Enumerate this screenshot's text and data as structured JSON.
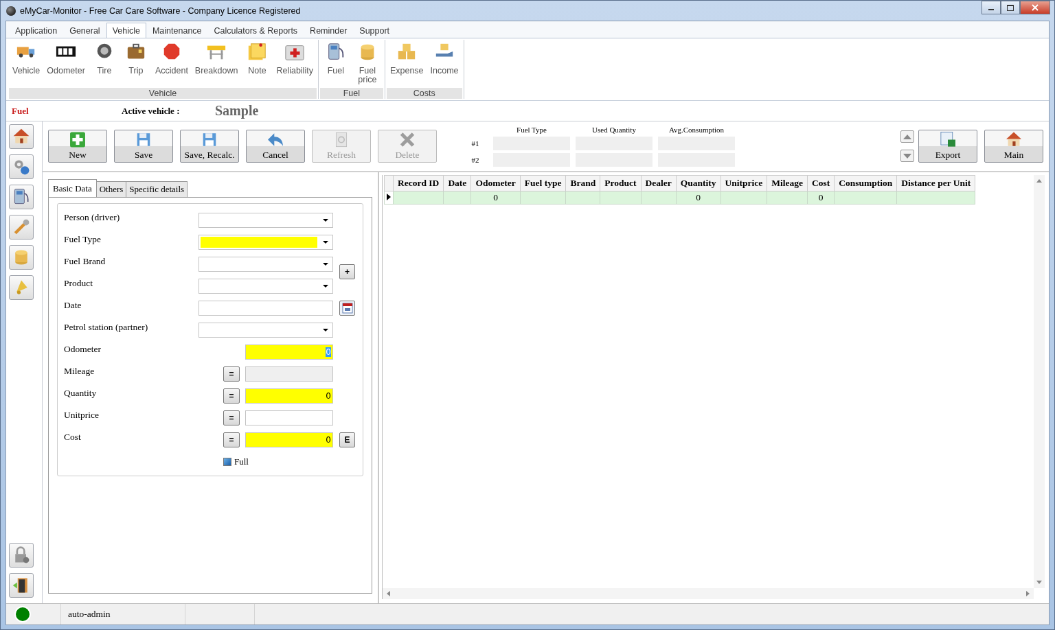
{
  "window": {
    "title": "eMyCar-Monitor - Free Car Care Software - Company Licence Registered"
  },
  "menu_tabs": [
    {
      "label": "Application",
      "selected": false
    },
    {
      "label": "General",
      "selected": false
    },
    {
      "label": "Vehicle",
      "selected": true
    },
    {
      "label": "Maintenance",
      "selected": false
    },
    {
      "label": "Calculators & Reports",
      "selected": false
    },
    {
      "label": "Reminder",
      "selected": false
    },
    {
      "label": "Support",
      "selected": false
    }
  ],
  "ribbon_groups": [
    {
      "title": "Vehicle",
      "items": [
        "Vehicle",
        "Odometer",
        "Tire",
        "Trip",
        "Accident",
        "Breakdown",
        "Note",
        "Reliability"
      ]
    },
    {
      "title": "Fuel",
      "items": [
        "Fuel",
        "Fuel price"
      ]
    },
    {
      "title": "Costs",
      "items": [
        "Expense",
        "Income"
      ]
    }
  ],
  "header": {
    "section": "Fuel",
    "active_vehicle_label": "Active vehicle :",
    "active_vehicle": "Sample"
  },
  "toolbar": [
    {
      "label": "New",
      "disabled": false
    },
    {
      "label": "Save",
      "disabled": false
    },
    {
      "label": "Save, Recalc.",
      "disabled": false
    },
    {
      "label": "Cancel",
      "disabled": false
    },
    {
      "label": "Refresh",
      "disabled": true
    },
    {
      "label": "Delete",
      "disabled": true
    }
  ],
  "summary": {
    "columns": [
      "Fuel Type",
      "Used Quantity",
      "Avg.Consumption"
    ],
    "rows": [
      "#1",
      "#2"
    ]
  },
  "right_buttons": [
    "Export",
    "Main"
  ],
  "form_tabs": [
    {
      "label": "Basic Data",
      "selected": true
    },
    {
      "label": "Others",
      "selected": false
    },
    {
      "label": "Specific details",
      "selected": false
    }
  ],
  "fields": [
    {
      "label": "Person (driver)",
      "kind": "combo",
      "required": false
    },
    {
      "label": "Fuel Type",
      "kind": "combo",
      "required": true
    },
    {
      "label": "Fuel Brand",
      "kind": "combo",
      "required": false,
      "side_button": "+"
    },
    {
      "label": "Product",
      "kind": "combo",
      "required": false
    },
    {
      "label": "Date",
      "kind": "date"
    },
    {
      "label": "Petrol station (partner)",
      "kind": "combo",
      "required": false
    },
    {
      "label": "Odometer",
      "kind": "number",
      "required": true,
      "value": "0",
      "selected_text": true
    },
    {
      "label": "Mileage",
      "kind": "number",
      "required": false,
      "readonly": true,
      "eq_button": "="
    },
    {
      "label": "Quantity",
      "kind": "number",
      "required": true,
      "value": "0",
      "eq_button": "="
    },
    {
      "label": "Unitprice",
      "kind": "number",
      "required": false,
      "eq_button": "="
    },
    {
      "label": "Cost",
      "kind": "number",
      "required": true,
      "value": "0",
      "eq_button": "=",
      "side_button": "E"
    }
  ],
  "full_checkbox": {
    "label": "Full",
    "checked": true
  },
  "table": {
    "columns": [
      "Record ID",
      "Date",
      "Odometer",
      "Fuel type",
      "Brand",
      "Product",
      "Dealer",
      "Quantity",
      "Unitprice",
      "Mileage",
      "Cost",
      "Consumption",
      "Distance per Unit"
    ],
    "rows": [
      {
        "current": true,
        "cells": [
          "",
          "",
          "0",
          "",
          "",
          "",
          "",
          "0",
          "",
          "",
          "0",
          "",
          ""
        ]
      }
    ]
  },
  "status_bar": {
    "online": true,
    "user": "auto-admin"
  }
}
